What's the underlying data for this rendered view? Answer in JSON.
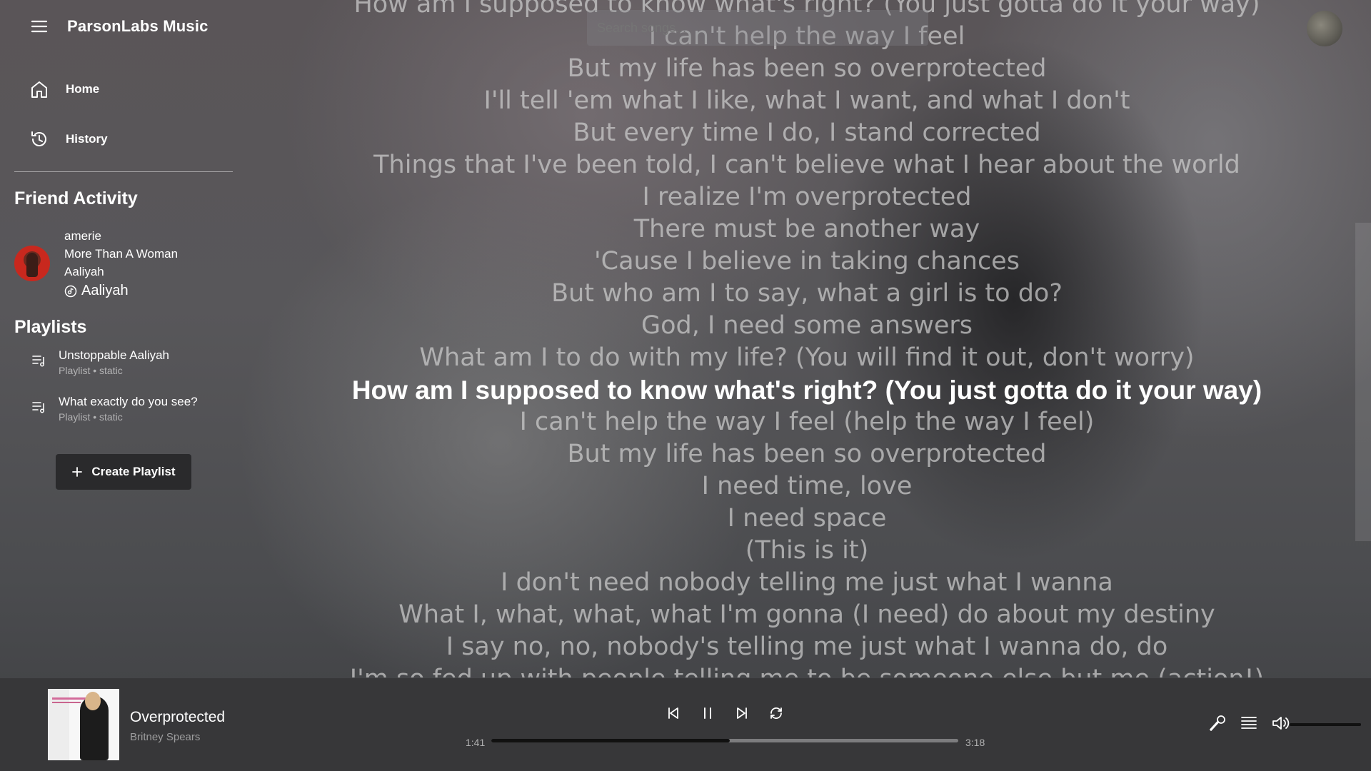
{
  "app": {
    "title": "ParsonLabs Music"
  },
  "nav": {
    "items": [
      {
        "label": "Home",
        "icon": "home-icon"
      },
      {
        "label": "History",
        "icon": "history-icon"
      }
    ]
  },
  "search": {
    "placeholder": "Search songs..."
  },
  "friend_activity": {
    "title": "Friend Activity",
    "friends": [
      {
        "username": "amerie",
        "song": "More Than A Woman",
        "album": "Aaliyah",
        "artist": "Aaliyah"
      }
    ]
  },
  "playlists": {
    "title": "Playlists",
    "items": [
      {
        "name": "Unstoppable Aaliyah",
        "meta": "Playlist • static"
      },
      {
        "name": "What exactly do you see?",
        "meta": "Playlist • static"
      }
    ],
    "create_label": "Create Playlist"
  },
  "lyrics": {
    "lines": [
      "How am I supposed to know what's right? (You just gotta do it your way)",
      "I can't help the way I feel",
      "But my life has been so overprotected",
      "I'll tell 'em what I like, what I want, and what I don't",
      "But every time I do, I stand corrected",
      "Things that I've been told, I can't believe what I hear about the world",
      "I realize I'm overprotected",
      "There must be another way",
      "'Cause I believe in taking chances",
      "But who am I to say, what a girl is to do?",
      "God, I need some answers",
      "What am I to do with my life? (You will find it out, don't worry)",
      "How am I supposed to know what's right? (You just gotta do it your way)",
      "I can't help the way I feel (help the way I feel)",
      "But my life has been so overprotected",
      "I need time, love",
      "I need space",
      "(This is it)",
      "I don't need nobody telling me just what I wanna",
      "What I, what, what, what I'm gonna (I need) do about my destiny",
      "I say no, no, nobody's telling me just what I wanna do, do",
      "I'm so fed up with people telling me to be someone else but me (action!)"
    ],
    "active_index": 12
  },
  "player": {
    "song": "Overprotected",
    "artist": "Britney Spears",
    "elapsed": "1:41",
    "duration": "3:18",
    "progress": 0.51,
    "volume": 1.0
  }
}
